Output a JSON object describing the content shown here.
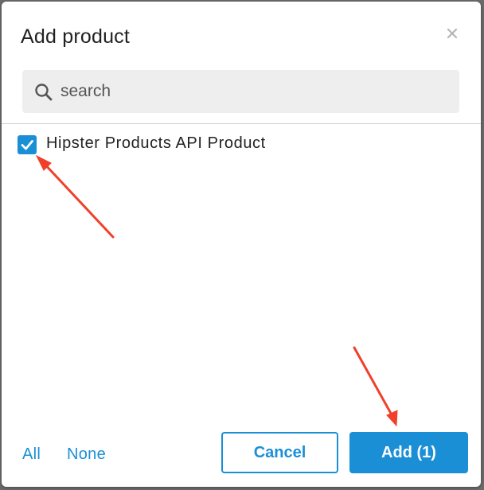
{
  "dialog": {
    "title": "Add product",
    "close_icon": "close-icon"
  },
  "search": {
    "placeholder": "search",
    "value": "",
    "icon": "search-icon"
  },
  "products": [
    {
      "label": "Hipster Products API Product",
      "checked": true
    }
  ],
  "footer": {
    "select_all_label": "All",
    "select_none_label": "None",
    "cancel_label": "Cancel",
    "add_label": "Add (1)"
  },
  "colors": {
    "accent": "#1a8fd6",
    "annotation_arrow": "#f0402a"
  }
}
